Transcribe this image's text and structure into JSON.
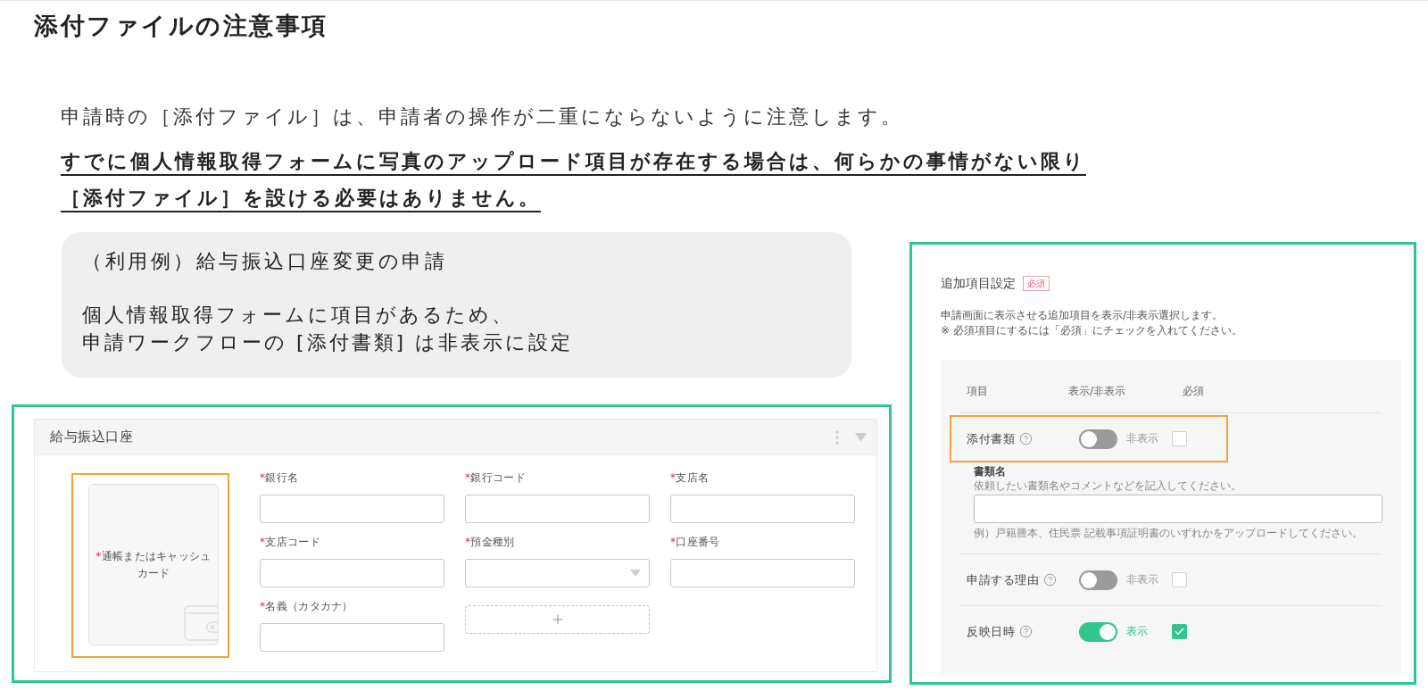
{
  "title": "添付ファイルの注意事項",
  "intro": "申請時の［添付ファイル］は、申請者の操作が二重にならないように注意します。",
  "notice_lines": [
    "すでに個人情報取得フォームに写真のアップロード項目が存在する場合は、何らかの事情がない限り",
    "［添付ファイル］を設ける必要はありません。"
  ],
  "example_callout": {
    "heading": "（利用例）給与振込口座変更の申請",
    "lines": [
      "個人情報取得フォームに項目があるため、",
      "申請ワークフローの [添付書類] は非表示に設定"
    ]
  },
  "form_card": {
    "title": "給与振込口座",
    "photo_field": {
      "required_mark": "*",
      "label": "通帳またはキャッシュカード",
      "highlighted": true
    },
    "fields": [
      {
        "kind": "text",
        "required_mark": "*",
        "label": "銀行名"
      },
      {
        "kind": "text",
        "required_mark": "*",
        "label": "銀行コード"
      },
      {
        "kind": "text",
        "required_mark": "*",
        "label": "支店名"
      },
      {
        "kind": "text",
        "required_mark": "*",
        "label": "支店コード"
      },
      {
        "kind": "select",
        "required_mark": "*",
        "label": "預金種別"
      },
      {
        "kind": "text",
        "required_mark": "*",
        "label": "口座番号"
      },
      {
        "kind": "text",
        "required_mark": "*",
        "label": "名義（カタカナ）"
      },
      {
        "kind": "add"
      }
    ]
  },
  "right_panel": {
    "title": "追加項目設定",
    "badge": "必須",
    "description": [
      "申請画面に表示させる追加項目を表示/非表示選択します。",
      "※ 必須項目にするには「必須」にチェックを入れてください。"
    ],
    "columns": [
      "項目",
      "表示/非表示",
      "必須"
    ],
    "rows": [
      {
        "label": "添付書類",
        "visible": false,
        "status": "非表示",
        "required": false,
        "highlighted": true,
        "detail": {
          "label": "書類名",
          "hint": "依頼したい書類名やコメントなどを記入してください。",
          "example": "例）戸籍謄本、住民票 記載事項証明書のいずれかをアップロードしてください。"
        }
      },
      {
        "label": "申請する理由",
        "visible": false,
        "status": "非表示",
        "required": false,
        "highlighted": false
      },
      {
        "label": "反映日時",
        "visible": true,
        "status": "表示",
        "required": true,
        "highlighted": false
      }
    ]
  }
}
